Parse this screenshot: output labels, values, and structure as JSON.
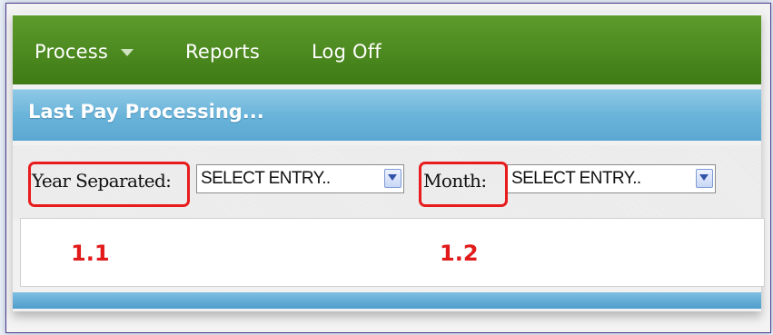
{
  "nav": {
    "items": [
      {
        "label": "Process",
        "has_dropdown": true
      },
      {
        "label": "Reports"
      },
      {
        "label": "Log Off"
      }
    ]
  },
  "page": {
    "title": "Last Pay Processing..."
  },
  "filters": {
    "year_label": "Year Separated:",
    "year_value": "SELECT ENTRY..",
    "month_label": "Month:",
    "month_value": "SELECT ENTRY.."
  },
  "annotations": {
    "year": "1.1",
    "month": "1.2"
  },
  "colors": {
    "nav_green": "#4a8a1f",
    "header_blue": "#6ab4da",
    "highlight_red": "#e81c1c"
  },
  "icons": {
    "dropdown": "chevron-down-icon",
    "nav_caret": "caret-down-icon"
  }
}
